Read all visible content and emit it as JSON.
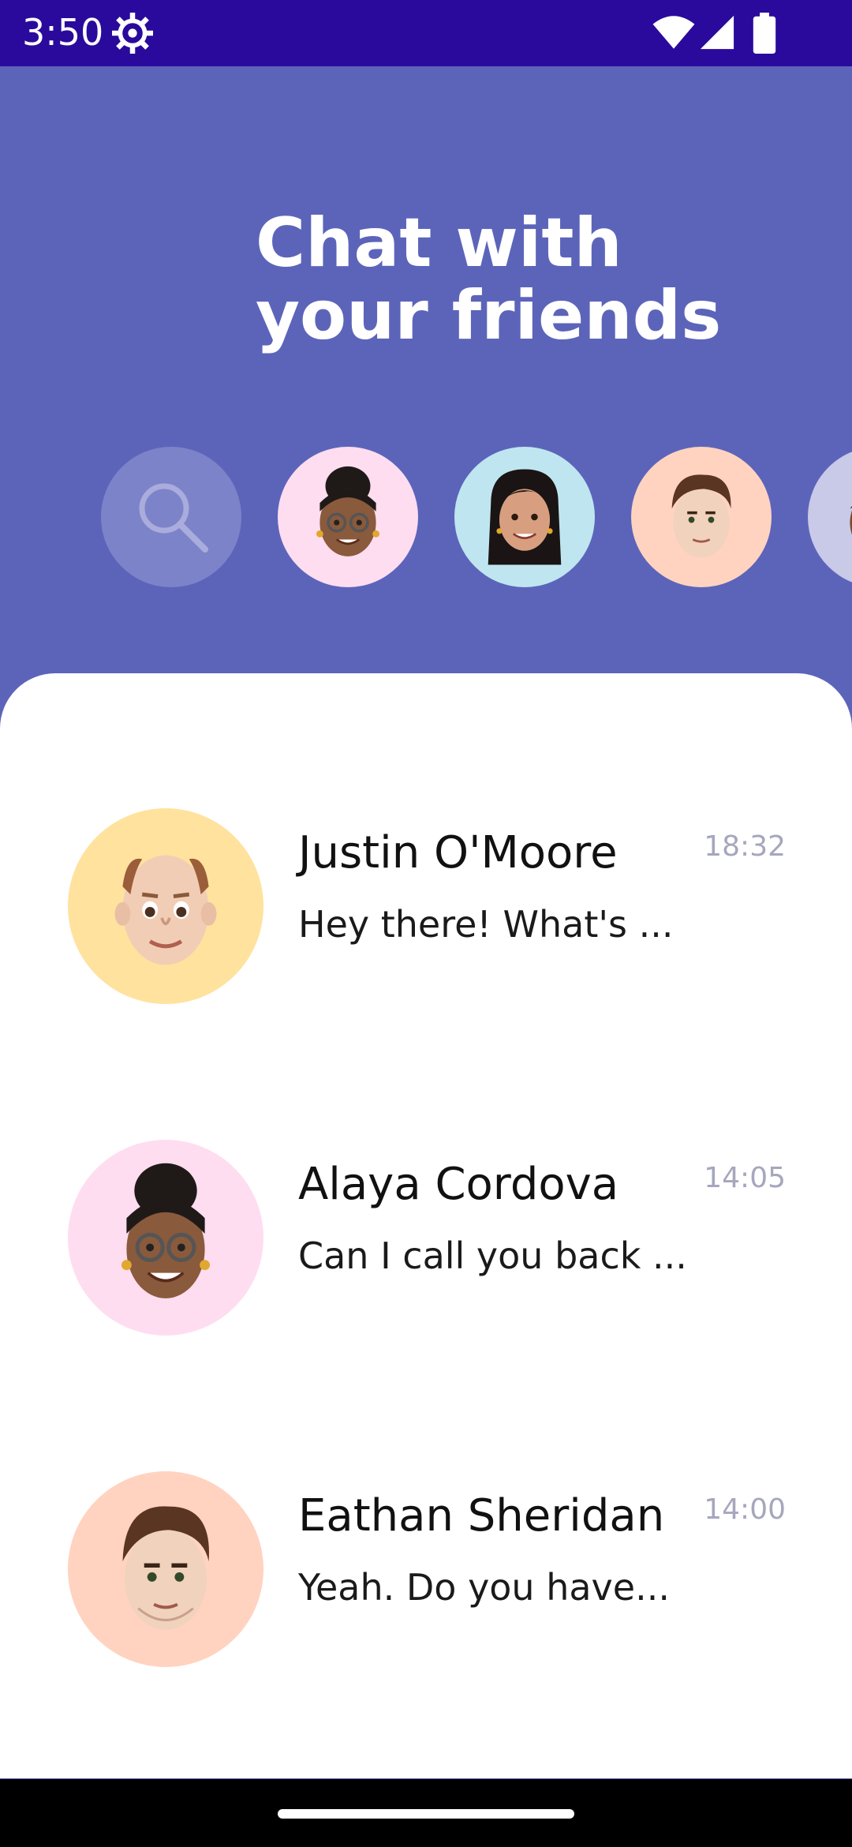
{
  "status_bar": {
    "time": "3:50",
    "icons": [
      "gear-icon",
      "wifi-icon",
      "signal-icon",
      "battery-icon"
    ]
  },
  "header": {
    "title_line1": "Chat with",
    "title_line2": "your friends"
  },
  "colors": {
    "status_bar": "#2A0A9C",
    "header_bg": "#5C64BA",
    "sheet_bg": "#FFFFFF",
    "time_text": "#A6A6BE"
  },
  "stories": [
    {
      "icon": "search-icon",
      "bg": "#7D83C8"
    },
    {
      "avatar": "alaya-cordova-avatar",
      "bg": "#FFDDF0"
    },
    {
      "avatar": "friend-avatar-long-hair",
      "bg": "#BFE6F0"
    },
    {
      "avatar": "eathan-sheridan-avatar",
      "bg": "#FFD3C0"
    },
    {
      "avatar": "friend-avatar-partial",
      "bg": "#C9C9E8"
    }
  ],
  "chats": [
    {
      "name": "Justin O'Moore",
      "message": "Hey there! What's ...",
      "time": "18:32",
      "avatar_bg": "#FFE29E"
    },
    {
      "name": "Alaya Cordova",
      "message": "Can I call you back ...",
      "time": "14:05",
      "avatar_bg": "#FFDDF0"
    },
    {
      "name": "Eathan Sheridan",
      "message": "Yeah. Do you have...",
      "time": "14:00",
      "avatar_bg": "#FFD3C0"
    }
  ]
}
